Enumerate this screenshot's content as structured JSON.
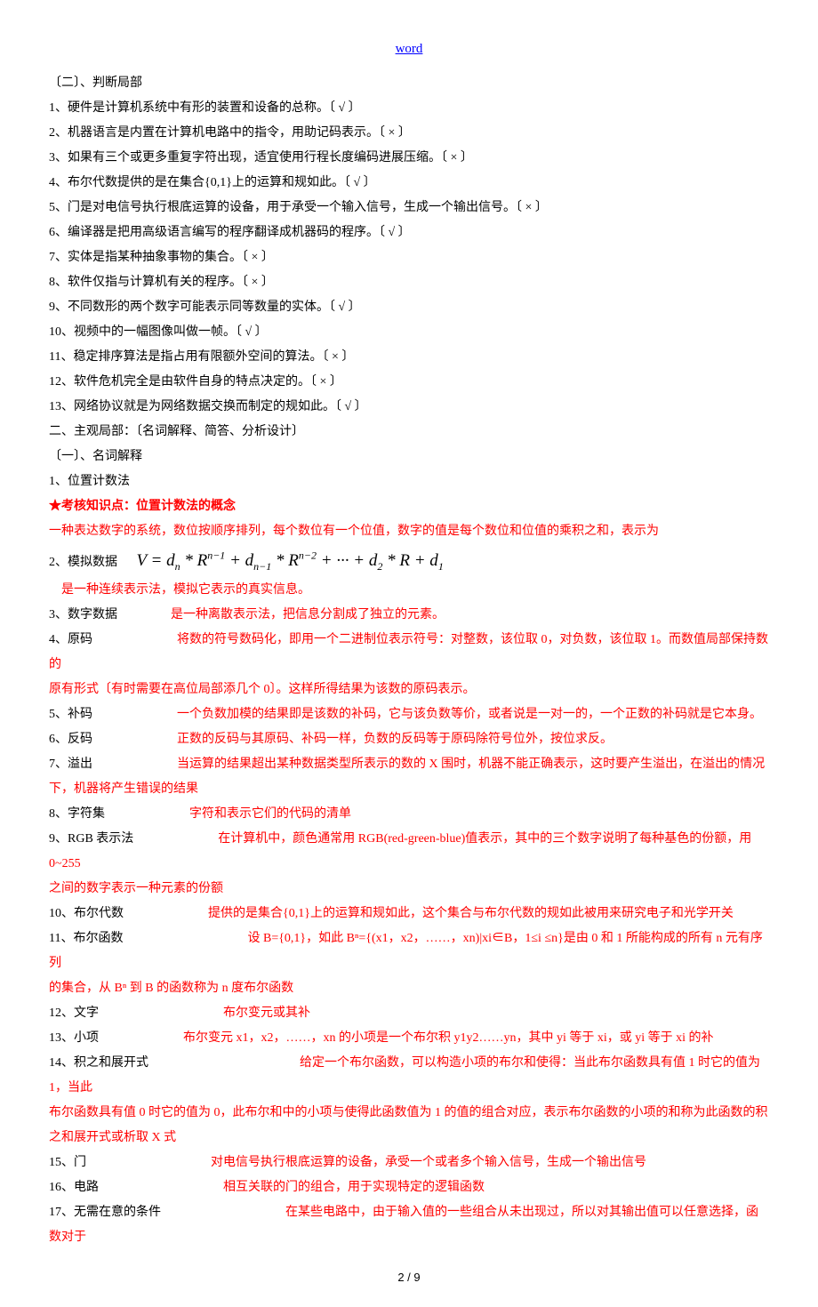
{
  "header": "word",
  "section_judge_title": "〔二〕、判断局部",
  "judge": [
    "1、硬件是计算机系统中有形的装置和设备的总称。〔 √ 〕",
    "2、机器语言是内置在计算机电路中的指令，用助记码表示。〔 × 〕",
    "3、如果有三个或更多重复字符出现，适宜使用行程长度编码进展压缩。〔 × 〕",
    "4、布尔代数提供的是在集合{0,1}上的运算和规如此。〔 √ 〕",
    "5、门是对电信号执行根底运算的设备，用于承受一个输入信号，生成一个输出信号。〔 × 〕",
    "6、编译器是把用高级语言编写的程序翻译成机器码的程序。〔 √ 〕",
    "7、实体是指某种抽象事物的集合。〔 × 〕",
    "8、软件仅指与计算机有关的程序。〔 × 〕",
    "9、不同数形的两个数字可能表示同等数量的实体。〔 √ 〕",
    "10、视频中的一幅图像叫做一帧。〔 √ 〕",
    "11、稳定排序算法是指占用有限额外空间的算法。〔 × 〕",
    "12、软件危机完全是由软件自身的特点决定的。〔 × 〕",
    "13、网络协议就是为网络数据交换而制定的规如此。〔 √ 〕"
  ],
  "subjective_title": "二、主观局部：〔名词解释、简答、分析设计〕",
  "terms_title": "〔一〕、名词解释",
  "t1_label": "1、位置计数法",
  "t1_kp": "★考核知识点：位置计数法的概念",
  "t1_ans": "一种表达数字的系统，数位按顺序排列，每个数位有一个位值，数字的值是每个数位和位值的乘积之和，表示为",
  "t2_label": "2、模拟数据",
  "t2_ans": "是一种连续表示法，模拟它表示的真实信息。",
  "t3_label": "3、数字数据",
  "t3_ans": "是一种离散表示法，把信息分割成了独立的元素。",
  "t4_label": "4、原码",
  "t4_ans_a": "将数的符号数码化，即用一个二进制位表示符号：对整数，该位取 0，对负数，该位取 1。而数值局部保持数的",
  "t4_ans_b": "原有形式〔有时需要在高位局部添几个 0〕。这样所得结果为该数的原码表示。",
  "t5_label": "5、补码",
  "t5_ans": "一个负数加模的结果即是该数的补码，它与该负数等价，或者说是一对一的，一个正数的补码就是它本身。",
  "t6_label": "6、反码",
  "t6_ans": "正数的反码与其原码、补码一样，负数的反码等于原码除符号位外，按位求反。",
  "t7_label": "7、溢出",
  "t7_ans_a": "当运算的结果超出某种数据类型所表示的数的 X 围时，机器不能正确表示，这时要产生溢出，在溢出的情况",
  "t7_ans_b": "下，机器将产生错误的结果",
  "t8_label": "8、字符集",
  "t8_ans": "字符和表示它们的代码的清单",
  "t9_label": "9、RGB 表示法",
  "t9_ans_a": "在计算机中，颜色通常用 RGB(red-green-blue)值表示，其中的三个数字说明了每种基色的份额，用 0~255",
  "t9_ans_b": "之间的数字表示一种元素的份额",
  "t10_label": "10、布尔代数",
  "t10_ans": "提供的是集合{0,1}上的运算和规如此，这个集合与布尔代数的规如此被用来研究电子和光学开关",
  "t11_label": "11、布尔函数",
  "t11_ans_a": "设 B={0,1}，如此 Bⁿ={(x1，x2，……，xn)|xi∈B，1≤i ≤n}是由 0 和 1 所能构成的所有 n 元有序列",
  "t11_ans_b": "的集合，从 Bⁿ 到 B 的函数称为 n 度布尔函数",
  "t12_label": "12、文字",
  "t12_ans": "布尔变元或其补",
  "t13_label": "13、小项",
  "t13_ans": "布尔变元 x1，x2，……，xn 的小项是一个布尔积 y1y2……yn，其中 yi 等于 xi，或 yi 等于 xi 的补",
  "t14_label": "14、积之和展开式",
  "t14_ans_a": "给定一个布尔函数，可以构造小项的布尔和使得：当此布尔函数具有值 1 时它的值为 1，当此",
  "t14_ans_b": "布尔函数具有值 0 时它的值为 0，此布尔和中的小项与使得此函数值为 1 的值的组合对应，表示布尔函数的小项的和称为此函数的积",
  "t14_ans_c": "之和展开式或析取 X 式",
  "t15_label": "15、门",
  "t15_ans": "对电信号执行根底运算的设备，承受一个或者多个输入信号，生成一个输出信号",
  "t16_label": "16、电路",
  "t16_ans": "相互关联的门的组合，用于实现特定的逻辑函数",
  "t17_label": "17、无需在意的条件",
  "t17_ans": "在某些电路中，由于输入值的一些组合从未出现过，所以对其输出值可以任意选择，函数对于",
  "page": "2 / 9"
}
